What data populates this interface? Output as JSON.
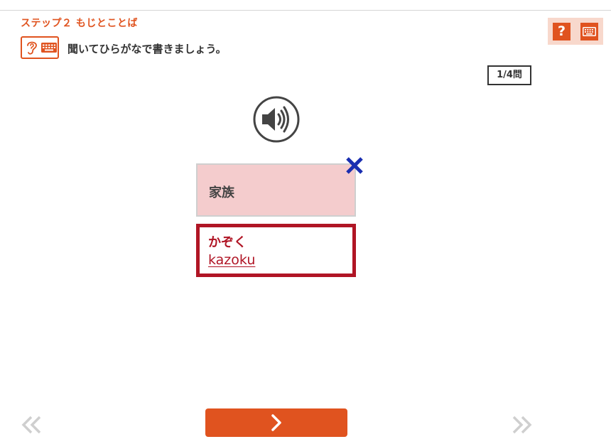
{
  "header": {
    "step_title": "ステップ２ もじとことば",
    "instruction": "聞いてひらがなで書きましょう。",
    "mode_icons": [
      "ear-icon",
      "keyboard-icon"
    ]
  },
  "toolbar": {
    "help_label": "?",
    "keyboard_icon": "keyboard-icon"
  },
  "progress": {
    "counter": "1/4問"
  },
  "question": {
    "word": "家族",
    "result_mark": "✕",
    "result": "incorrect"
  },
  "answer": {
    "kana": "かぞく",
    "romaji": "kazoku"
  },
  "navigation": {
    "prev_icon": "double-chevron-left-icon",
    "next_icon": "double-chevron-right-icon",
    "next_button_icon": "chevron-right-icon"
  },
  "colors": {
    "accent": "#e0531f",
    "help_panel_bg": "#f8d8cc",
    "question_bg": "#f4cccd",
    "answer_red": "#b01525",
    "wrong_mark": "#1a2eb0",
    "nav_disabled": "#cfcfcf"
  }
}
